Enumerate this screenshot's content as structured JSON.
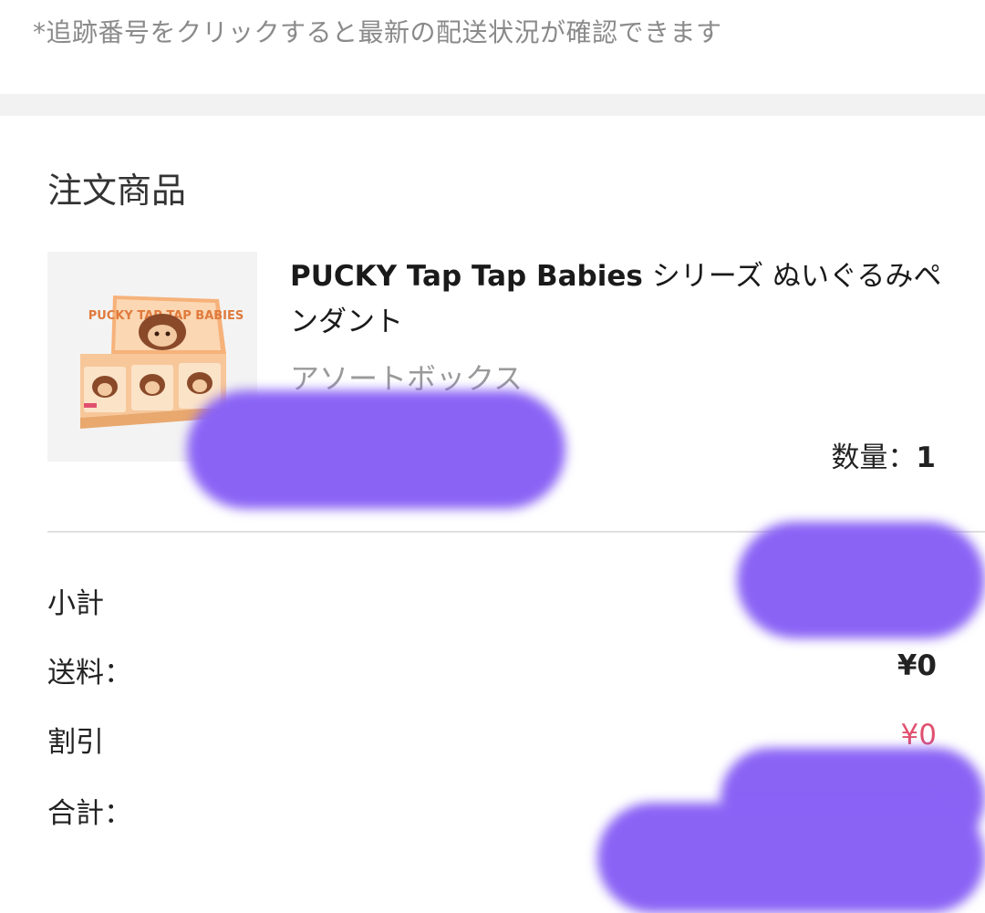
{
  "tracking_note": "*追跡番号をクリックすると最新の配送状況が確認できます",
  "order": {
    "section_title": "注文商品",
    "item": {
      "name_bold": "PUCKY Tap Tap Babies",
      "name_rest": " シリーズ ぬいぐるみペンダント",
      "variant": "アソートボックス",
      "quantity_label": "数量：",
      "quantity_value": "1",
      "image_alt": "PUCKY Tap Tap Babies box",
      "box_text": "PUCKY TAP TAP BABIES"
    }
  },
  "summary": {
    "subtotal_label": "小計",
    "shipping_label": "送料：",
    "shipping_value": "¥0",
    "discount_label": "割引",
    "discount_value": "¥0",
    "total_label": "合計："
  },
  "colors": {
    "discount": "#e0506e",
    "redaction": "#8a63f5"
  }
}
